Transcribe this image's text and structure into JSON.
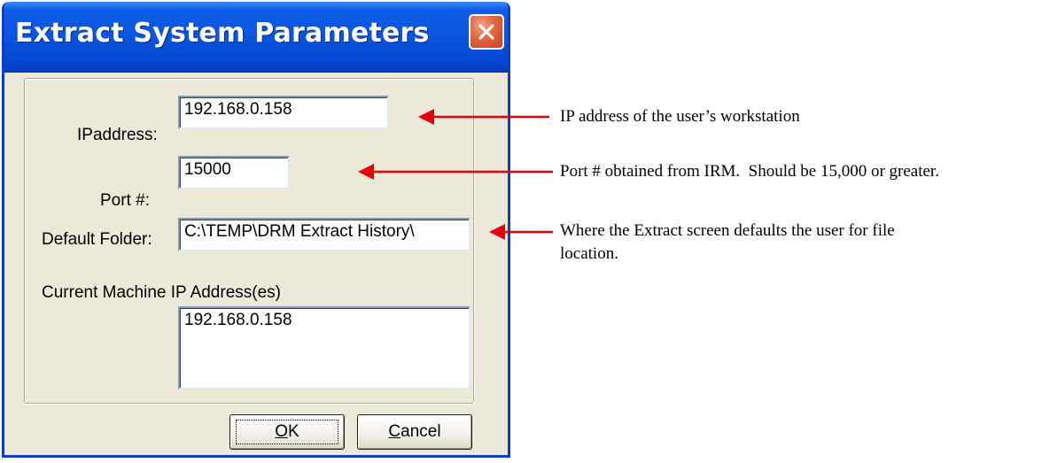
{
  "dialog": {
    "title": "Extract System Parameters",
    "ip_label": "IPaddress:",
    "ip_value": "192.168.0.158",
    "port_label": "Port #:",
    "port_value": "15000",
    "folder_label": "Default Folder:",
    "folder_value": "C:\\TEMP\\DRM Extract History\\",
    "current_ip_label": "Current Machine IP Address(es)",
    "current_ip_list": "192.168.0.158",
    "ok_label_pre": "",
    "ok_label_u": "O",
    "ok_label_post": "K",
    "cancel_label_u": "C",
    "cancel_label_post": "ancel"
  },
  "annotations": {
    "ip_note": "IP address of the user’s workstation",
    "port_note": "Port # obtained from IRM.  Should be 15,000 or greater.",
    "folder_note_line1": "Where the Extract screen defaults the user for file",
    "folder_note_line2": "location."
  },
  "colors": {
    "arrow": "#e8000b",
    "title_bar": "#0a55e0",
    "dialog_face": "#ece9d8"
  }
}
